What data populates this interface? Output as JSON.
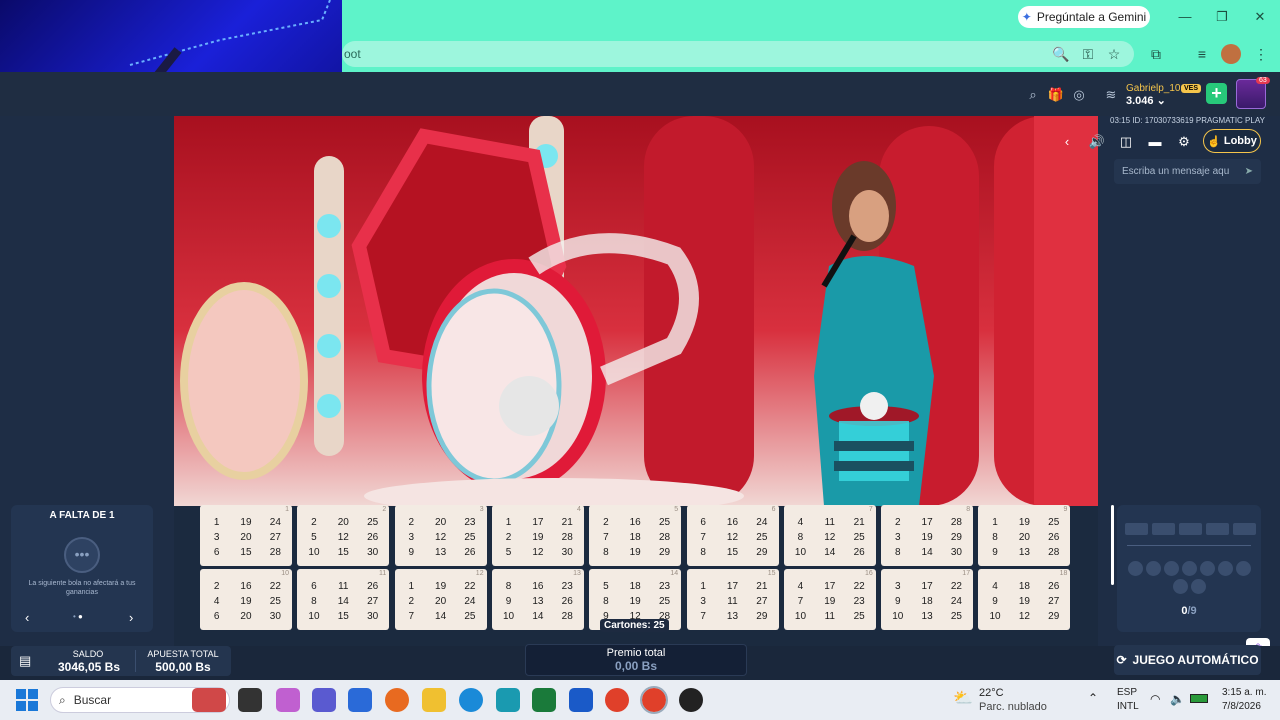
{
  "browser": {
    "gemini_label": "Pregúntale a Gemini",
    "address_fragment": "oot"
  },
  "header": {
    "user_name": "Gabrielp_10",
    "balance": "3.046",
    "currency_badge": "VES",
    "avatar_count": "63"
  },
  "stream": {
    "game_info": "03:15 ID: 17030733619 PRAGMATIC PLAY",
    "lobby_label": "Lobby",
    "chat_placeholder": "Escriba un mensaje aqu"
  },
  "left_panel": {
    "title": "A FALTA DE 1",
    "message": "La siguiente bola no afectará a tus ganancias"
  },
  "cards": [
    {
      "n": "1",
      "v": [
        "1",
        "19",
        "24",
        "3",
        "20",
        "27",
        "6",
        "15",
        "28"
      ]
    },
    {
      "n": "2",
      "v": [
        "2",
        "20",
        "25",
        "5",
        "12",
        "26",
        "10",
        "15",
        "30"
      ]
    },
    {
      "n": "3",
      "v": [
        "2",
        "20",
        "23",
        "3",
        "12",
        "25",
        "9",
        "13",
        "26"
      ]
    },
    {
      "n": "4",
      "v": [
        "1",
        "17",
        "21",
        "2",
        "19",
        "28",
        "5",
        "12",
        "30"
      ]
    },
    {
      "n": "5",
      "v": [
        "2",
        "16",
        "25",
        "7",
        "18",
        "28",
        "8",
        "19",
        "29"
      ]
    },
    {
      "n": "6",
      "v": [
        "6",
        "16",
        "24",
        "7",
        "12",
        "25",
        "8",
        "15",
        "29"
      ]
    },
    {
      "n": "7",
      "v": [
        "4",
        "11",
        "21",
        "8",
        "12",
        "25",
        "10",
        "14",
        "26"
      ]
    },
    {
      "n": "8",
      "v": [
        "2",
        "17",
        "28",
        "3",
        "19",
        "29",
        "8",
        "14",
        "30"
      ]
    },
    {
      "n": "9",
      "v": [
        "1",
        "19",
        "25",
        "8",
        "20",
        "26",
        "9",
        "13",
        "28"
      ]
    },
    {
      "n": "10",
      "v": [
        "2",
        "16",
        "22",
        "4",
        "19",
        "25",
        "6",
        "20",
        "30"
      ]
    },
    {
      "n": "11",
      "v": [
        "6",
        "11",
        "26",
        "8",
        "14",
        "27",
        "10",
        "15",
        "30"
      ]
    },
    {
      "n": "12",
      "v": [
        "1",
        "19",
        "22",
        "2",
        "20",
        "24",
        "7",
        "14",
        "25"
      ]
    },
    {
      "n": "13",
      "v": [
        "8",
        "16",
        "23",
        "9",
        "13",
        "26",
        "10",
        "14",
        "28"
      ]
    },
    {
      "n": "14",
      "v": [
        "5",
        "18",
        "23",
        "8",
        "19",
        "25",
        "9",
        "12",
        "28"
      ]
    },
    {
      "n": "15",
      "v": [
        "1",
        "17",
        "21",
        "3",
        "11",
        "27",
        "7",
        "13",
        "29"
      ]
    },
    {
      "n": "16",
      "v": [
        "4",
        "17",
        "22",
        "7",
        "19",
        "23",
        "10",
        "11",
        "25"
      ]
    },
    {
      "n": "17",
      "v": [
        "3",
        "17",
        "22",
        "9",
        "18",
        "24",
        "10",
        "13",
        "25"
      ]
    },
    {
      "n": "18",
      "v": [
        "4",
        "18",
        "26",
        "9",
        "19",
        "27",
        "10",
        "12",
        "29"
      ]
    }
  ],
  "cartones_label": "Cartones: 25",
  "tracker": {
    "count": "0",
    "total": "/9"
  },
  "bottom": {
    "saldo_label": "SALDO",
    "saldo_value": "3046,05 Bs",
    "apuesta_label": "APUESTA TOTAL",
    "apuesta_value": "500,00 Bs",
    "premio_label": "Premio total",
    "premio_value": "0,00 Bs",
    "auto_label": "JUEGO AUTOMÁTICO"
  },
  "taskbar": {
    "search_placeholder": "Buscar",
    "temp": "22°C",
    "weather": "Parc. nublado",
    "lang1": "ESP",
    "lang2": "INTL",
    "time": "3:15 a. m.",
    "date": "7/8/2026"
  },
  "colors": {
    "accent": "#5ef3c9",
    "gold": "#f5c54b",
    "panel": "#1e2d45"
  }
}
